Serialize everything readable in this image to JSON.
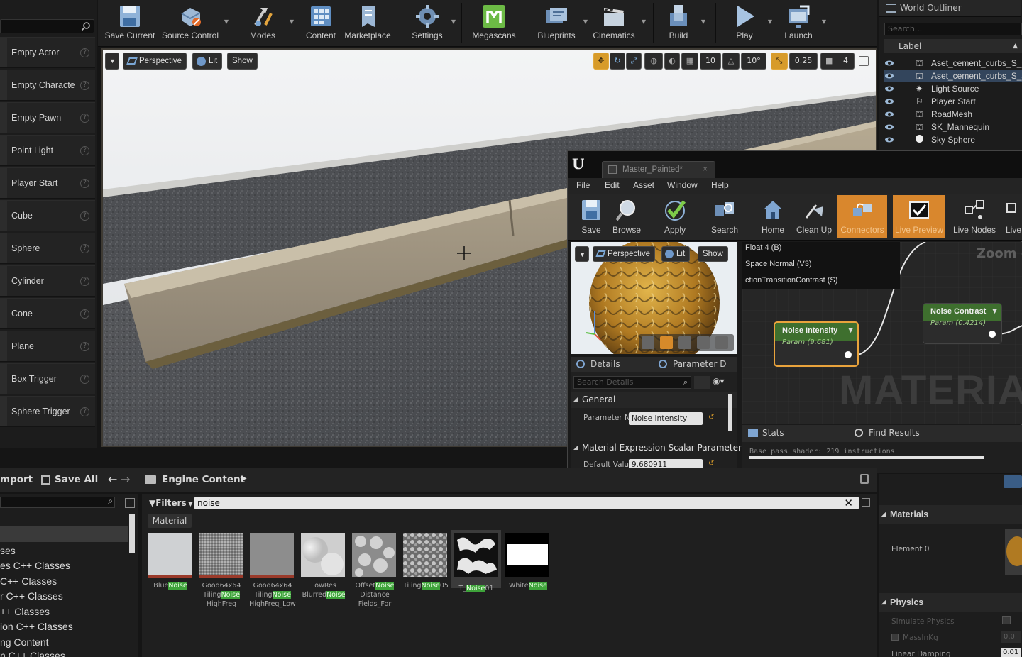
{
  "left_panel": {
    "items": [
      {
        "label": "Empty Actor"
      },
      {
        "label": "Empty Characte"
      },
      {
        "label": "Empty Pawn"
      },
      {
        "label": "Point Light"
      },
      {
        "label": "Player Start"
      },
      {
        "label": "Cube"
      },
      {
        "label": "Sphere"
      },
      {
        "label": "Cylinder"
      },
      {
        "label": "Cone"
      },
      {
        "label": "Plane"
      },
      {
        "label": "Box Trigger"
      },
      {
        "label": "Sphere Trigger"
      }
    ],
    "help_glyph": "?"
  },
  "toolbar": {
    "buttons": [
      {
        "label": "Save Current",
        "icon": "save-icon"
      },
      {
        "label": "Source Control",
        "icon": "source-control-icon"
      },
      {
        "label": "Modes",
        "icon": "modes-icon"
      },
      {
        "label": "Content",
        "icon": "content-icon"
      },
      {
        "label": "Marketplace",
        "icon": "marketplace-icon"
      },
      {
        "label": "Settings",
        "icon": "settings-icon"
      },
      {
        "label": "Megascans",
        "icon": "megascans-icon"
      },
      {
        "label": "Blueprints",
        "icon": "blueprints-icon"
      },
      {
        "label": "Cinematics",
        "icon": "cinematics-icon"
      },
      {
        "label": "Build",
        "icon": "build-icon"
      },
      {
        "label": "Play",
        "icon": "play-icon"
      },
      {
        "label": "Launch",
        "icon": "launch-icon"
      }
    ]
  },
  "viewport": {
    "perspective_label": "Perspective",
    "lit_label": "Lit",
    "show_label": "Show",
    "grid_snap": "10",
    "rotation_snap": "10°",
    "scale_snap": "0.25",
    "camera_speed": "4"
  },
  "outliner": {
    "tab_title": "World Outliner",
    "search_placeholder": "Search...",
    "column_label": "Label",
    "rows": [
      {
        "name": "Aset_cement_curbs_S_se",
        "selected": false
      },
      {
        "name": "Aset_cement_curbs_S_se",
        "selected": true
      },
      {
        "name": "Light Source",
        "selected": false
      },
      {
        "name": "Player Start",
        "selected": false
      },
      {
        "name": "RoadMesh",
        "selected": false
      },
      {
        "name": "SK_Mannequin",
        "selected": false
      },
      {
        "name": "Sky Sphere",
        "selected": false
      }
    ]
  },
  "material_editor": {
    "tab_title": "Master_Painted*",
    "menu": [
      "File",
      "Edit",
      "Asset",
      "Window",
      "Help"
    ],
    "tools": [
      {
        "label": "Save",
        "active": false
      },
      {
        "label": "Browse",
        "active": false
      },
      {
        "label": "Apply",
        "active": false
      },
      {
        "label": "Search",
        "active": false
      },
      {
        "label": "Home",
        "active": false
      },
      {
        "label": "Clean Up",
        "active": false
      },
      {
        "label": "Connectors",
        "active": true
      },
      {
        "label": "Live Preview",
        "active": true
      },
      {
        "label": "Live Nodes",
        "active": false
      },
      {
        "label": "Live",
        "active": false
      }
    ],
    "preview": {
      "perspective": "Perspective",
      "lit": "Lit",
      "show": "Show"
    },
    "graph_info": [
      "Float 4 (B)",
      "Space Normal (V3)",
      "ctionTransitionContrast (S)"
    ],
    "zoom_label": "Zoom -",
    "watermark": "MATERIAL",
    "nodes": [
      {
        "title": "Noise Intensity",
        "subtitle": "Param (9.681)"
      },
      {
        "title": "Noise Contrast",
        "subtitle": "Param (0.4214)"
      }
    ],
    "details": {
      "tab1": "Details",
      "tab2": "Parameter D",
      "search_placeholder": "Search Details",
      "general_header": "General",
      "param_label": "Parameter N",
      "param_value": "Noise Intensity",
      "section2": "Material Expression Scalar Parameter",
      "default_label": "Default Valu",
      "default_value": "9.680911"
    },
    "stats": {
      "tab1": "Stats",
      "tab2": "Find Results",
      "line": "Base pass shader: 219 instructions"
    }
  },
  "content_browser": {
    "import_label": "mport",
    "save_all_label": "Save All",
    "path_label": "Engine Content",
    "filters_label": "Filters",
    "search_value": "noise",
    "filter_chip": "Material",
    "tree": [
      "ses",
      "es C++ Classes",
      "C++ Classes",
      "r C++ Classes",
      "++ Classes",
      "ion C++ Classes",
      "ng Content",
      "n C++ Classes"
    ],
    "assets": [
      {
        "pre": "Blue",
        "match": "Noise",
        "post": "",
        "line2": "",
        "line3": ""
      },
      {
        "pre": "Good64x64",
        "match": "",
        "post": "",
        "line2a": "Tiling",
        "line2m": "Noise",
        "line3": "HighFreq"
      },
      {
        "pre": "Good64x64",
        "match": "",
        "post": "",
        "line2a": "Tiling",
        "line2m": "Noise",
        "line3": "HighFreq_Low"
      },
      {
        "pre": "LowRes",
        "match": "",
        "post": "",
        "line2a": "Blurred",
        "line2m": "Noise",
        "line3": ""
      },
      {
        "pre": "Offset",
        "match": "Noise",
        "post": "",
        "line2a": "Distance",
        "line2m": "",
        "line3": "Fields_For"
      },
      {
        "pre": "Tiling",
        "match": "Noise",
        "post": "05",
        "line2a": "",
        "line2m": "",
        "line3": ""
      },
      {
        "pre": "T_",
        "match": "Noise",
        "post": "01",
        "line2a": "",
        "line2m": "",
        "line3": ""
      },
      {
        "pre": "White",
        "match": "Noise",
        "post": "",
        "line2a": "",
        "line2m": "",
        "line3": ""
      }
    ]
  },
  "right_details": {
    "materials_header": "Materials",
    "element_label": "Element 0",
    "physics_header": "Physics",
    "simulate_label": "Simulate Physics",
    "mass_label": "MassInKg",
    "mass_value": "0.0",
    "damping_label": "Linear Damping",
    "damping_value": "0.01"
  }
}
